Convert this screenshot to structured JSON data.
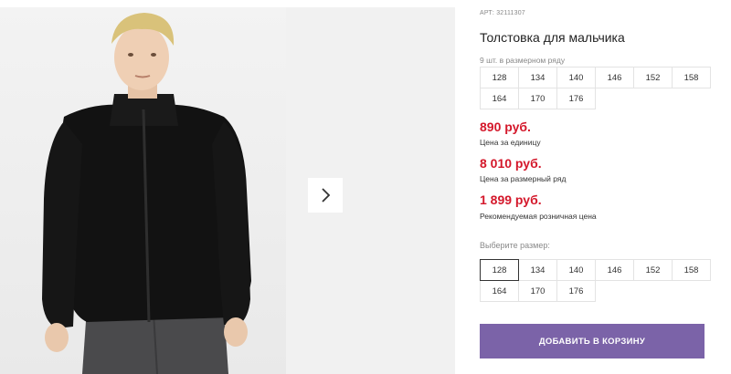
{
  "product": {
    "sku": "АРТ: 32111307",
    "title": "Толстовка для мальчика",
    "row_note": "9 шт. в размерном ряду",
    "row_sizes": [
      "128",
      "134",
      "140",
      "146",
      "152",
      "158",
      "164",
      "170",
      "176"
    ],
    "prices": [
      {
        "value": "890 руб.",
        "label": "Цена за единицу"
      },
      {
        "value": "8 010 руб.",
        "label": "Цена за размерный ряд"
      },
      {
        "value": "1 899 руб.",
        "label": "Рекомендуемая розничная цена"
      }
    ],
    "choose_label": "Выберите размер:",
    "size_options": [
      "128",
      "134",
      "140",
      "146",
      "152",
      "158",
      "164",
      "170",
      "176"
    ],
    "selected_size": "128",
    "add_to_cart_label": "ДОБАВИТЬ В КОРЗИНУ"
  },
  "gallery": {
    "next_icon": "chevron-right-icon"
  },
  "colors": {
    "price": "#d4182b",
    "button": "#7b63a8"
  }
}
